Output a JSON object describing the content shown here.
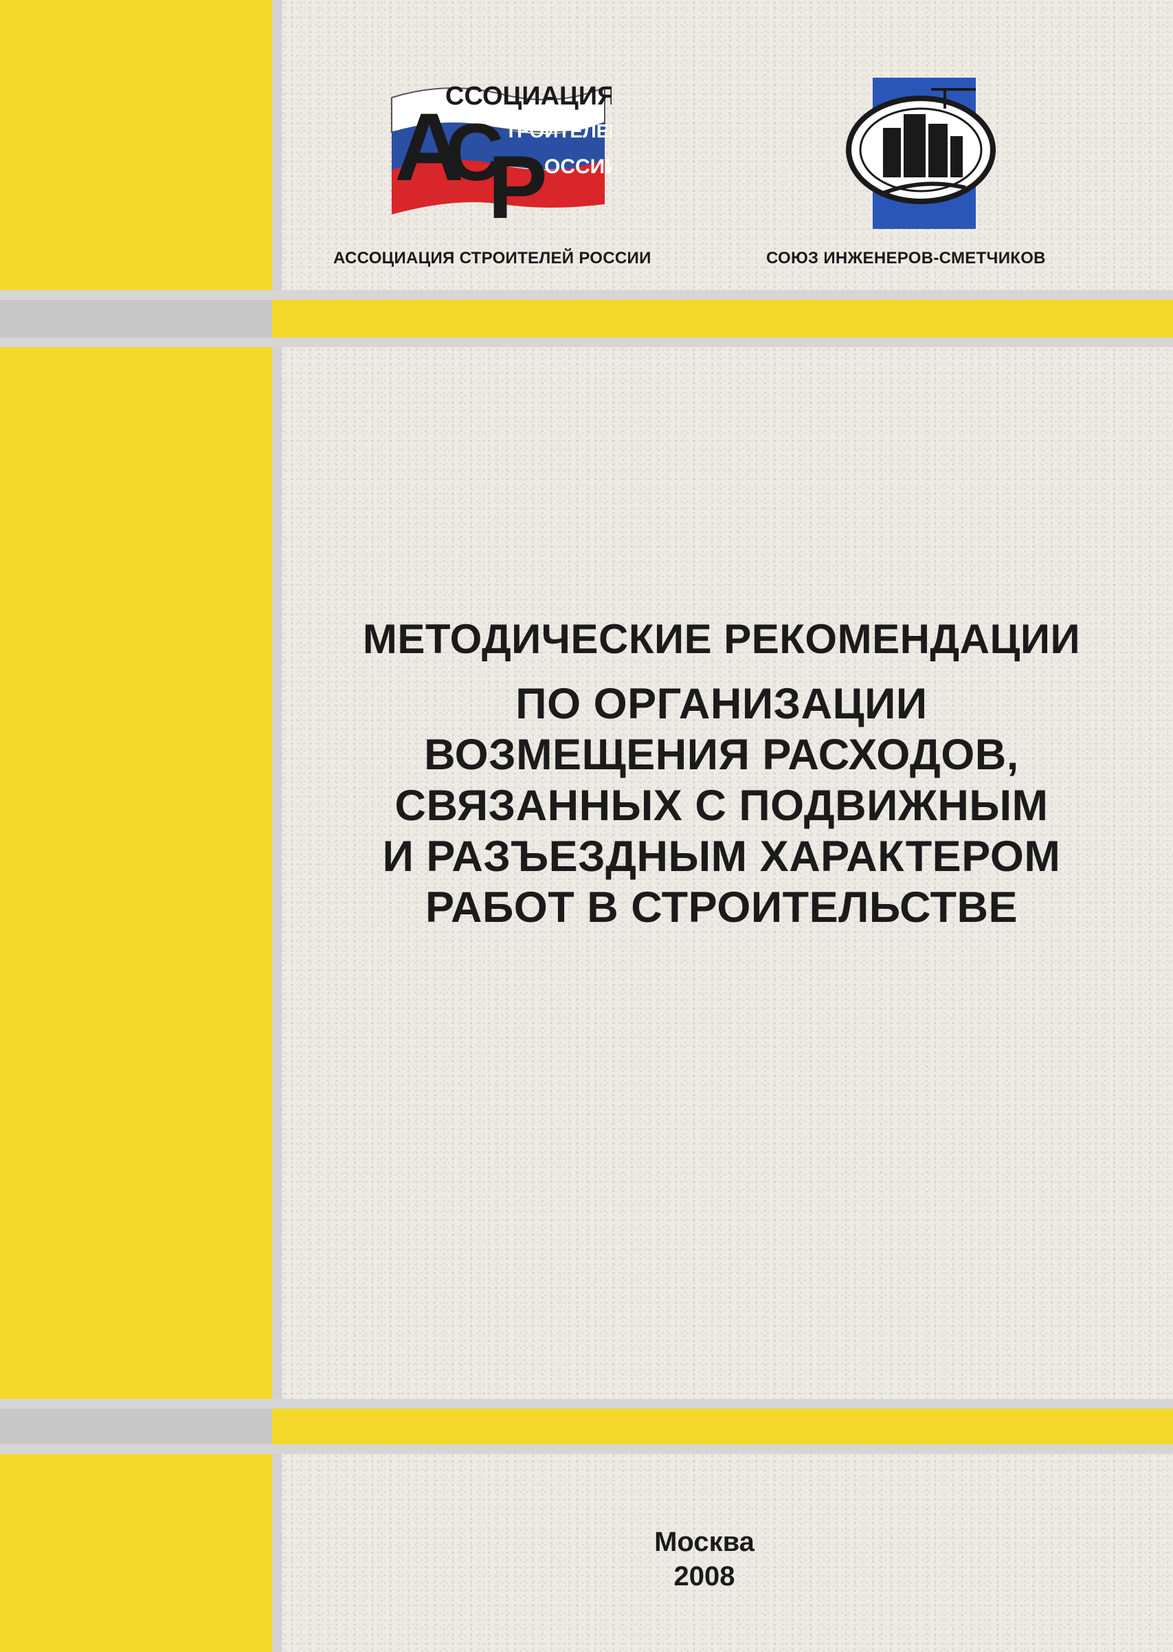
{
  "logos": {
    "left_logo_text": [
      "ССОЦИАЦИЯ",
      "ТРОИТЕЛЕЙ",
      "ОССИИ"
    ],
    "left_logo_letters": [
      "А",
      "С",
      "Р"
    ],
    "left_caption": "АССОЦИАЦИЯ СТРОИТЕЛЕЙ РОССИИ",
    "right_caption": "СОЮЗ ИНЖЕНЕРОВ-СМЕТЧИКОВ"
  },
  "title": {
    "line1": "МЕТОДИЧЕСКИЕ РЕКОМЕНДАЦИИ",
    "lines": [
      "ПО ОРГАНИЗАЦИИ",
      "ВОЗМЕЩЕНИЯ РАСХОДОВ,",
      "СВЯЗАННЫХ С ПОДВИЖНЫМ",
      "И РАЗЪЕЗДНЫМ ХАРАКТЕРОМ",
      "РАБОТ В СТРОИТЕЛЬСТВЕ"
    ]
  },
  "footer": {
    "city": "Москва",
    "year": "2008"
  },
  "colors": {
    "yellow": "#f4d92a",
    "grey": "#d2d2d2",
    "text": "#1b1b1b"
  }
}
